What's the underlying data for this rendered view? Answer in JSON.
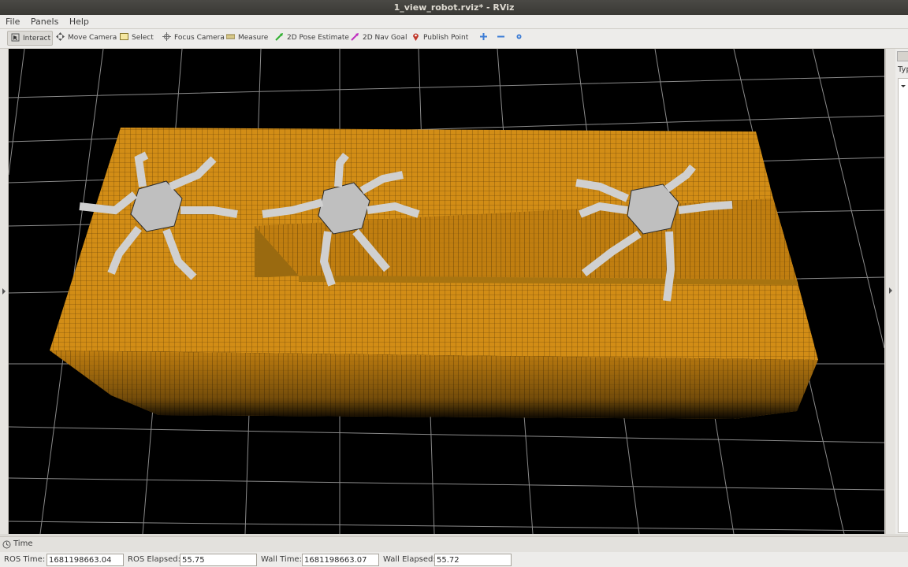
{
  "window": {
    "title": "1_view_robot.rviz* - RViz"
  },
  "menu": {
    "file": "File",
    "panels": "Panels",
    "help": "Help"
  },
  "toolbar": {
    "interact": "Interact",
    "move_camera": "Move Camera",
    "select": "Select",
    "focus_camera": "Focus Camera",
    "measure": "Measure",
    "pose_estimate": "2D Pose Estimate",
    "nav_goal": "2D Nav Goal",
    "publish_point": "Publish Point"
  },
  "right_panel": {
    "type_label": "Typ"
  },
  "time_panel": {
    "title": "Time",
    "ros_time_label": "ROS Time:",
    "ros_time": "1681198663.04",
    "ros_elapsed_label": "ROS Elapsed:",
    "ros_elapsed": "55.75",
    "wall_time_label": "Wall Time:",
    "wall_time": "1681198663.07",
    "wall_elapsed_label": "Wall Elapsed:",
    "wall_elapsed": "55.72"
  },
  "colors": {
    "terrain": "#d08c14",
    "background": "#000000",
    "grid": "#8a8a8a"
  }
}
